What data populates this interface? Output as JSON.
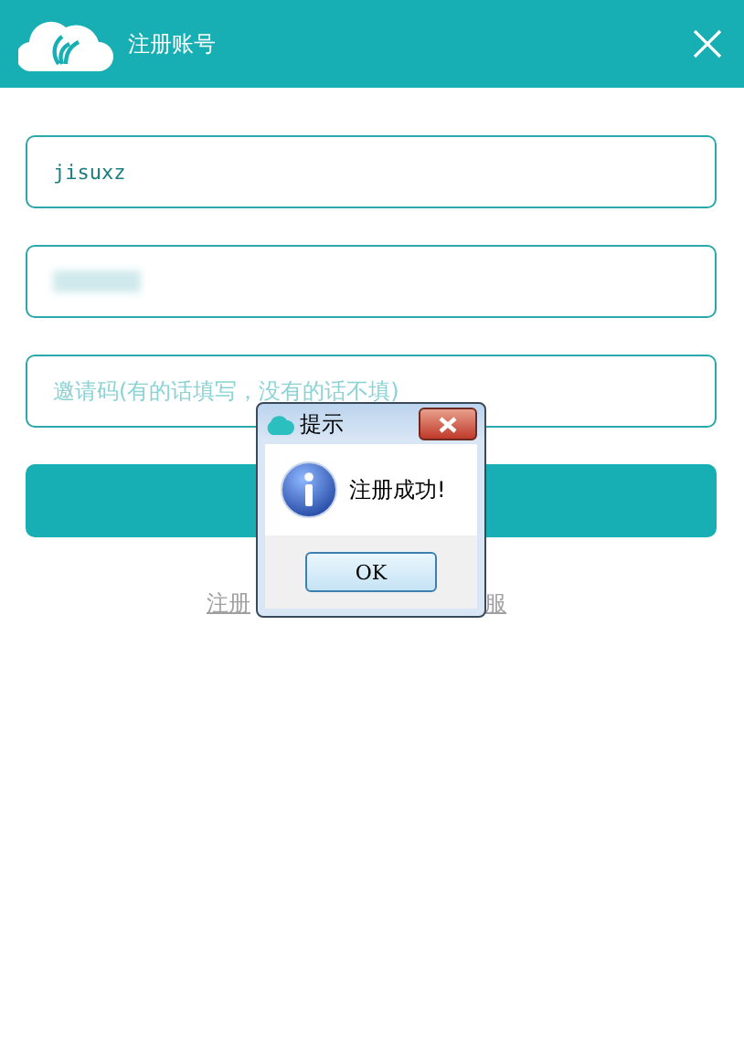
{
  "window": {
    "title": "注册账号"
  },
  "fields": [
    {
      "kind": "text",
      "value": "jisuxz"
    },
    {
      "kind": "masked"
    },
    {
      "kind": "text",
      "placeholder": "邀请码(有的话填写，没有的话不填)"
    }
  ],
  "footer_link": {
    "parts": [
      "注册",
      "服"
    ]
  },
  "dialog": {
    "title": "提示",
    "message": "注册成功!",
    "buttons": [
      "OK"
    ]
  }
}
